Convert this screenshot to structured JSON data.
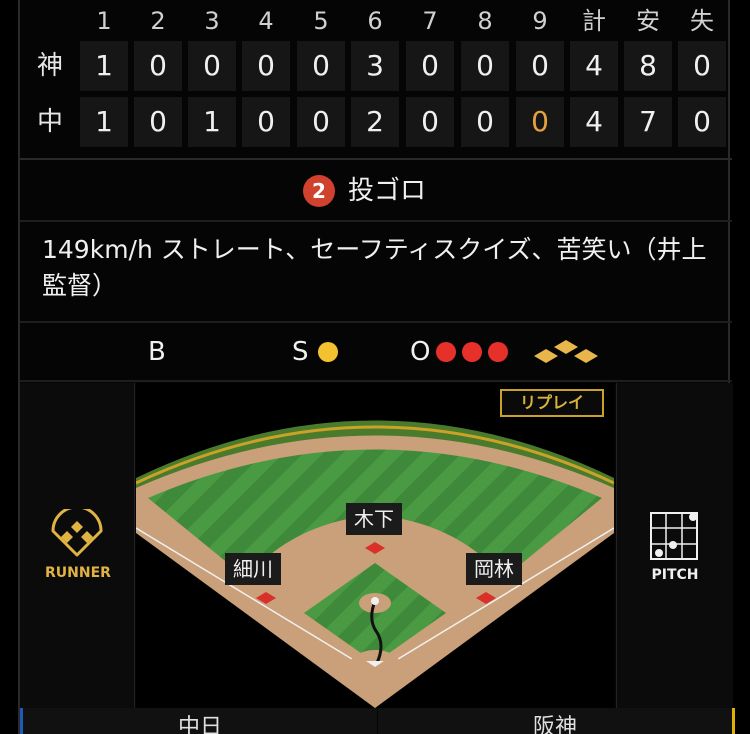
{
  "scoreboard": {
    "innings": [
      "1",
      "2",
      "3",
      "4",
      "5",
      "6",
      "7",
      "8",
      "9"
    ],
    "totals_headers": [
      "計",
      "安",
      "失"
    ],
    "teams": [
      {
        "name": "神",
        "runs": [
          "1",
          "0",
          "0",
          "0",
          "0",
          "3",
          "0",
          "0",
          "0"
        ],
        "total": "4",
        "hits": "8",
        "errors": "0"
      },
      {
        "name": "中",
        "runs": [
          "1",
          "0",
          "1",
          "0",
          "0",
          "2",
          "0",
          "0",
          "0"
        ],
        "total": "4",
        "hits": "7",
        "errors": "0"
      }
    ],
    "current_inning_color": "#e6a23c"
  },
  "play": {
    "badge": "2",
    "result": "投ゴロ",
    "badge_color": "#d0412e"
  },
  "comment": "149km/h ストレート、セーフティスクイズ、苦笑い（井上監督）",
  "count": {
    "ball_label": "B",
    "strike_label": "S",
    "out_label": "O",
    "balls": 0,
    "strikes": 1,
    "outs": 3,
    "strike_color": "#f2c230",
    "out_color": "#e8302b",
    "base_color": "#e8b64a"
  },
  "field": {
    "replay_label": "リプレイ",
    "runner_caption": "RUNNER",
    "pitch_caption": "PITCH",
    "fielders": {
      "center": "木下",
      "left": "細川",
      "right": "岡林"
    },
    "accent_color": "#c9a227"
  },
  "tabs": {
    "left": "中日",
    "right": "阪神"
  }
}
